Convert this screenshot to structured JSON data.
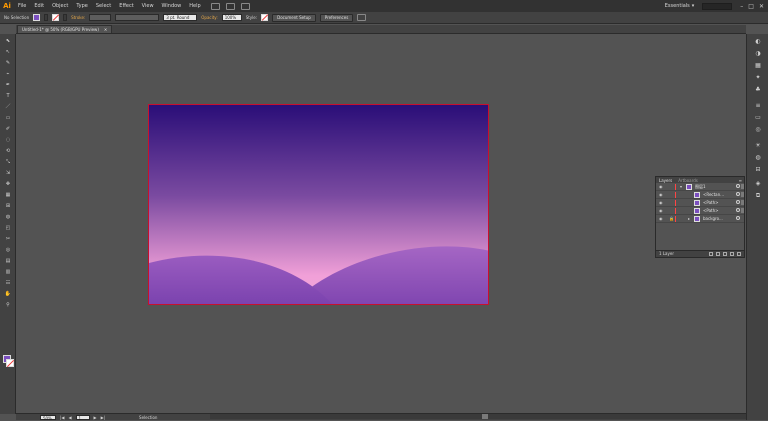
{
  "app": {
    "logo": "Ai"
  },
  "menu": [
    "File",
    "Edit",
    "Object",
    "Type",
    "Select",
    "Effect",
    "View",
    "Window",
    "Help"
  ],
  "workspace": {
    "label": "Essentials",
    "caret": "▾"
  },
  "window_controls": [
    "–",
    "□",
    "✕"
  ],
  "controlbar": {
    "selection_label": "No Selection",
    "stroke_label": "Stroke:",
    "brush_label": "3 pt. Round",
    "opacity_label": "Opacity:",
    "opacity_value": "100%",
    "style_label": "Style:",
    "document_setup": "Document Setup",
    "preferences": "Preferences",
    "fill_color": "#7b4fbf"
  },
  "document_tab": {
    "title": "Untitled-1* @ 50% (RGB/GPU Preview)",
    "close": "✕"
  },
  "tools": [
    "⬉",
    "↖",
    "✎",
    "⌁",
    "✒",
    "T",
    "／",
    "▭",
    "✐",
    "◌",
    "⟲",
    "⤡",
    "⇲",
    "✥",
    "▦",
    "⊞",
    "◍",
    "◰",
    "✂",
    "◎",
    "▤",
    "▥",
    "☷",
    "✋",
    "⚲"
  ],
  "layers_panel": {
    "tabs": [
      "Layers",
      "Artboards"
    ],
    "menu": "≡",
    "rows": [
      {
        "name": "图层1",
        "type": "layer",
        "expander": "▾"
      },
      {
        "name": "<Rectan...",
        "type": "item",
        "expander": ""
      },
      {
        "name": "<Path>",
        "type": "item",
        "expander": ""
      },
      {
        "name": "<Path>",
        "type": "item",
        "expander": ""
      },
      {
        "name": "backgro...",
        "type": "group",
        "expander": "▸"
      }
    ],
    "footer": "1 Layer"
  },
  "statusbar": {
    "zoom": "50%",
    "page": "1",
    "mode": "Selection"
  },
  "artwork": {
    "sky_top": "#2a0e78",
    "sky_mid": "#7a4aa0",
    "sky_bottom": "#f1a0d8",
    "hill_back": "#9c5ec0",
    "hill_front": "#8a4db4",
    "border": "#c8102e"
  }
}
